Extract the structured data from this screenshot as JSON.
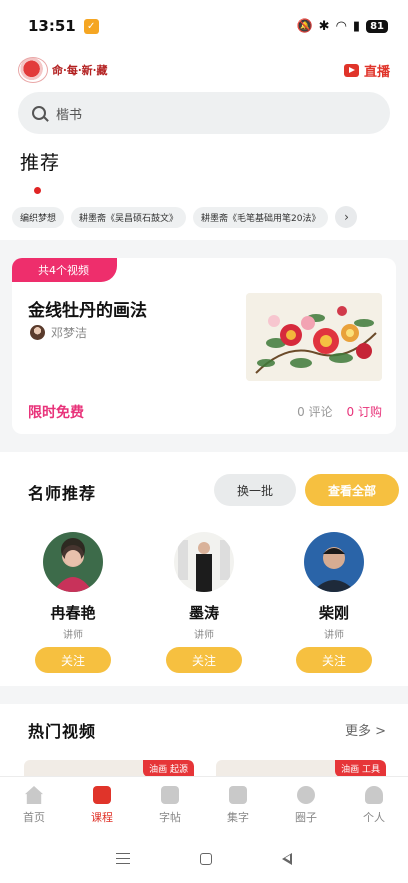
{
  "status_bar": {
    "time": "13:51",
    "battery": "81"
  },
  "header": {
    "logo_text": "命·每·新·藏",
    "live_label": "直播"
  },
  "search": {
    "placeholder": "楷书"
  },
  "recommend": {
    "title": "推荐",
    "chips": [
      "编织梦想",
      "耕墨斋《吴昌硕石鼓文》",
      "耕墨斋《毛笔基础用笔20法》"
    ]
  },
  "featured_course": {
    "badge": "共4个视频",
    "title": "金线牡丹的画法",
    "teacher": "邓梦洁",
    "price_label": "限时免费",
    "comments": "0 评论",
    "orders": "0 订购"
  },
  "teachers_section": {
    "title": "名师推荐",
    "switch_label": "换一批",
    "view_all_label": "查看全部",
    "teachers": [
      {
        "name": "冉春艳",
        "role": "讲师",
        "follow": "关注"
      },
      {
        "name": "墨涛",
        "role": "讲师",
        "follow": "关注"
      },
      {
        "name": "柴刚",
        "role": "讲师",
        "follow": "关注"
      }
    ]
  },
  "hot_videos": {
    "title": "热门视频",
    "more_label": "更多 >",
    "cards": [
      {
        "tag": "油画 起源"
      },
      {
        "tag": "油画 工具"
      }
    ]
  },
  "tabs": [
    {
      "label": "首页",
      "icon": "home-icon",
      "active": false
    },
    {
      "label": "课程",
      "icon": "course-icon",
      "active": true
    },
    {
      "label": "字帖",
      "icon": "copybook-icon",
      "active": false
    },
    {
      "label": "集字",
      "icon": "collect-icon",
      "active": false
    },
    {
      "label": "圈子",
      "icon": "circle-icon",
      "active": false
    },
    {
      "label": "个人",
      "icon": "user-icon",
      "active": false
    }
  ],
  "colors": {
    "accent": "#e0342a",
    "pink": "#ee2e6c",
    "yellow": "#f6c040"
  }
}
